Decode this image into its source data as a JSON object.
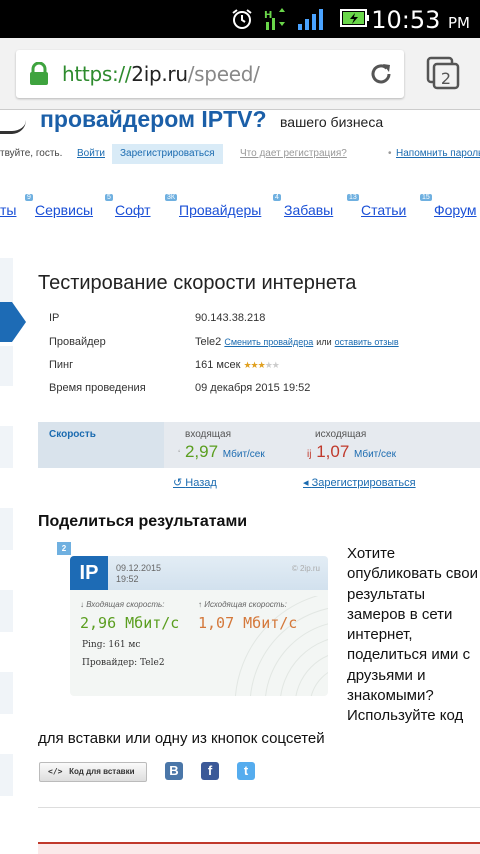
{
  "statusbar": {
    "time": "10:53",
    "ampm": "PM"
  },
  "browser": {
    "url_scheme": "https://",
    "url_host": "2ip.ru",
    "url_path": "/speed/",
    "tab_count": "2"
  },
  "banner": {
    "title": "провайдером IPTV?",
    "subtitle": "вашего бизнеса"
  },
  "loginbar": {
    "greeting": "твуйте, гость.",
    "login_label": "Войти",
    "register_label": "Зарегистрироваться",
    "why_label": "Что дает регистрация?",
    "remind_label": "Напомнить пароль"
  },
  "menu": {
    "items": [
      {
        "label": "ты",
        "num": ""
      },
      {
        "label": "Сервисы",
        "num": "9"
      },
      {
        "label": "Софт",
        "num": "5"
      },
      {
        "label": "Провайдеры",
        "num": "3К"
      },
      {
        "label": "Забавы",
        "num": "4"
      },
      {
        "label": "Статьи",
        "num": "13"
      },
      {
        "label": "Форум",
        "num": "15"
      }
    ]
  },
  "page_title": "Тестирование скорости интернета",
  "info": {
    "ip_label": "IP",
    "ip_value": "90.143.38.218",
    "provider_label": "Провайдер",
    "provider_value": "Tele2",
    "provider_change": "Сменить провайдера",
    "provider_or": "или",
    "provider_review": "оставить отзыв",
    "ping_label": "Пинг",
    "ping_value": "161 мсек",
    "ping_rating": 2.5,
    "time_label": "Время проведения",
    "time_value": "09 декабря 2015 19:52"
  },
  "speed": {
    "label": "Скорость",
    "in_caption": "входящая",
    "in_value": "2,97",
    "in_unit": "Мбит/сек",
    "out_caption": "исходящая",
    "out_value": "1,07",
    "out_unit": "Мбит/сек"
  },
  "nav": {
    "back": "Назад",
    "register": "Зарегистрироваться"
  },
  "share": {
    "title": "Поделиться результатами",
    "badge": "2",
    "card": {
      "logo": "IP",
      "date": "09.12.2015",
      "time": "19:52",
      "watermark": "© 2ip.ru",
      "in_caption": "↓ Входящая скорость:",
      "in_value": "2,96 Мбит/с",
      "out_caption": "↑ Исходящая скорость:",
      "out_value": "1,07 Мбит/с",
      "ping": "Ping: 161 мс",
      "provider": "Провайдер: Tele2"
    },
    "side_text": "Хотите опубликовать свои результаты замеров в сети интернет, поделиться ими с друзьями и знакомыми? Используйте код",
    "bottom_text": "для вставки или одну из кнопок соцсетей",
    "code_button": "Код для вставки",
    "social": {
      "vk": "B",
      "facebook": "f",
      "twitter": "t"
    }
  },
  "colors": {
    "accent": "#1b6bb0",
    "green": "#5a9e1f",
    "red": "#c0392b",
    "menu_link": "#1a4fd6"
  }
}
